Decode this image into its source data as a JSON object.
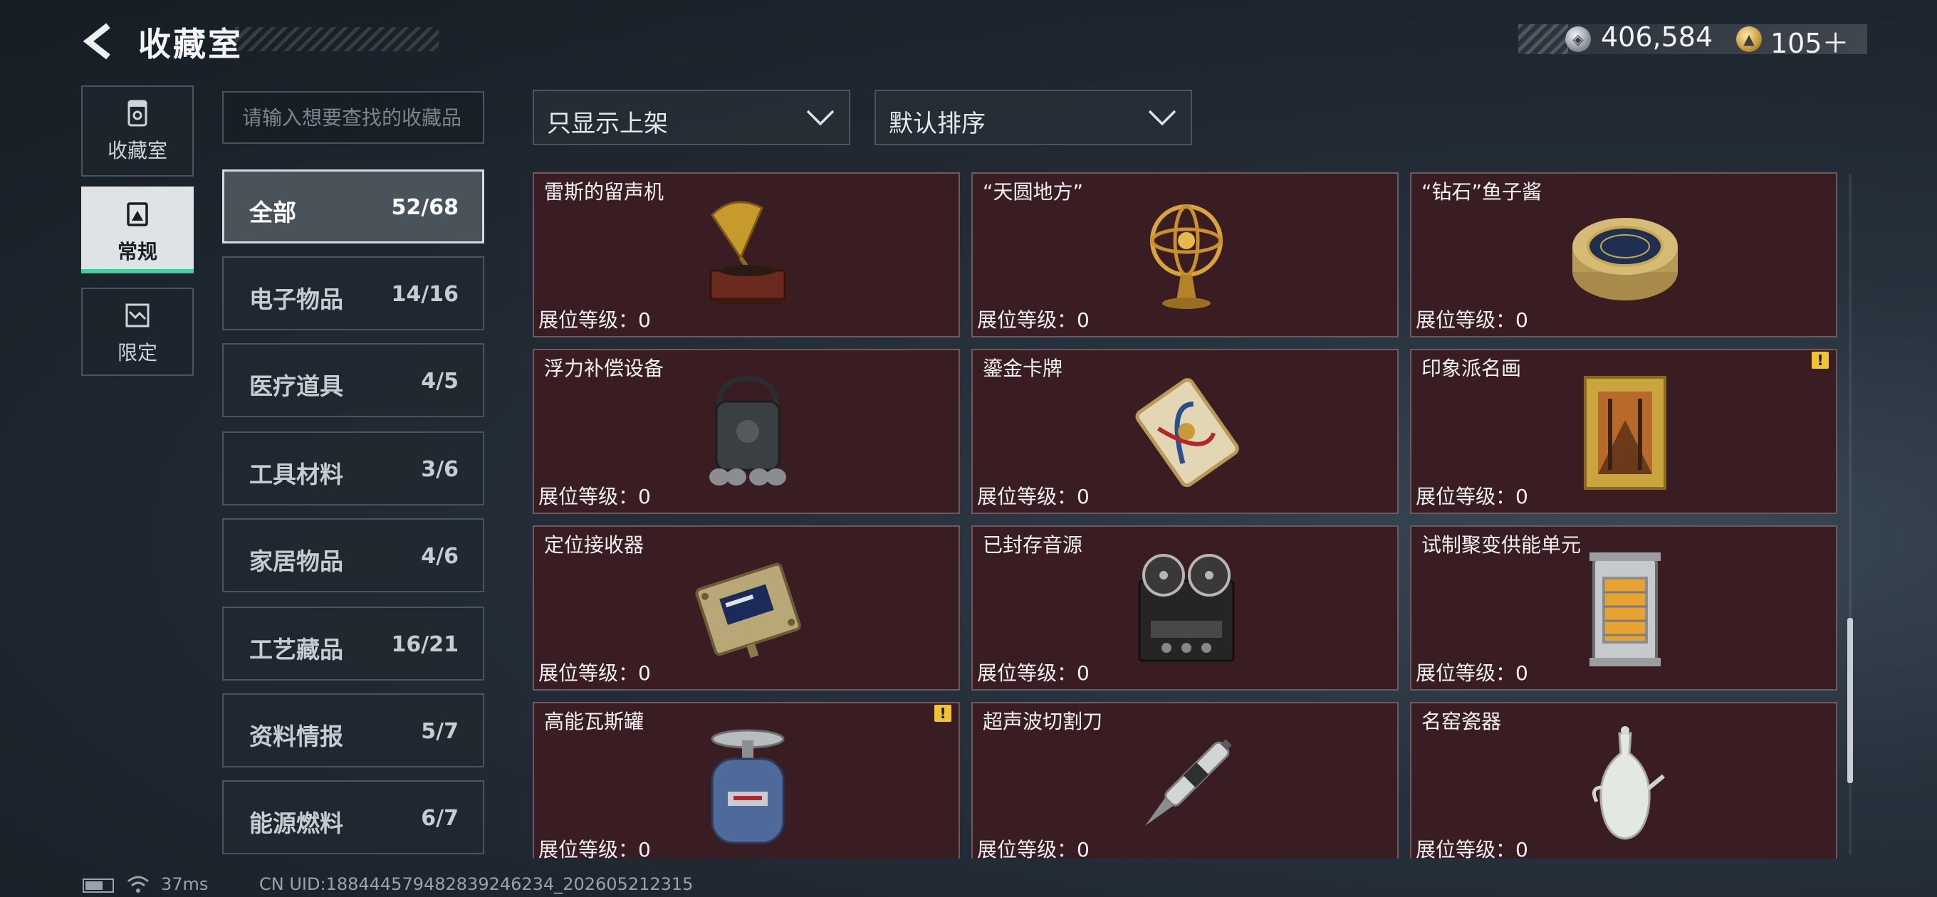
{
  "header": {
    "title": "收藏室",
    "currency_silver": "406,584",
    "currency_gold": "105＋"
  },
  "nav": [
    {
      "label": "收藏室",
      "icon": "collection-room-icon"
    },
    {
      "label": "常规",
      "icon": "regular-frame-icon"
    },
    {
      "label": "限定",
      "icon": "limited-icon"
    }
  ],
  "search": {
    "placeholder": "请输入想要查找的收藏品"
  },
  "filter": {
    "selected": "只显示上架"
  },
  "sort": {
    "selected": "默认排序"
  },
  "categories": [
    {
      "name": "全部",
      "count": "52/68"
    },
    {
      "name": "电子物品",
      "count": "14/16"
    },
    {
      "name": "医疗道具",
      "count": "4/5"
    },
    {
      "name": "工具材料",
      "count": "3/6"
    },
    {
      "name": "家居物品",
      "count": "4/6"
    },
    {
      "name": "工艺藏品",
      "count": "16/21"
    },
    {
      "name": "资料情报",
      "count": "5/7"
    },
    {
      "name": "能源燃料",
      "count": "6/7"
    }
  ],
  "items": [
    {
      "name": "雷斯的留声机",
      "level": "展位等级：0",
      "icon": "gramophone-icon"
    },
    {
      "name": "“天圆地方”",
      "level": "展位等级：0",
      "icon": "armillary-sphere-icon"
    },
    {
      "name": "“钻石”鱼子酱",
      "level": "展位等级：0",
      "icon": "caviar-tin-icon"
    },
    {
      "name": "浮力补偿设备",
      "level": "展位等级：0",
      "icon": "buoyancy-device-icon"
    },
    {
      "name": "鎏金卡牌",
      "level": "展位等级：0",
      "icon": "gilded-card-icon"
    },
    {
      "name": "印象派名画",
      "level": "展位等级：0",
      "icon": "framed-painting-icon",
      "warning": "!"
    },
    {
      "name": "定位接收器",
      "level": "展位等级：0",
      "icon": "receiver-device-icon"
    },
    {
      "name": "已封存音源",
      "level": "展位等级：0",
      "icon": "reel-to-reel-icon"
    },
    {
      "name": "试制聚变供能单元",
      "level": "展位等级：0",
      "icon": "fusion-cell-icon"
    },
    {
      "name": "高能瓦斯罐",
      "level": "展位等级：0",
      "icon": "gas-canister-icon",
      "warning": "!"
    },
    {
      "name": "超声波切割刀",
      "level": "展位等级：0",
      "icon": "ultrasonic-cutter-icon"
    },
    {
      "name": "名窑瓷器",
      "level": "展位等级：0",
      "icon": "porcelain-vase-icon"
    }
  ],
  "status": {
    "ping": "37ms",
    "uid": "CN UID:18844457948283924623​4_202605212315"
  }
}
